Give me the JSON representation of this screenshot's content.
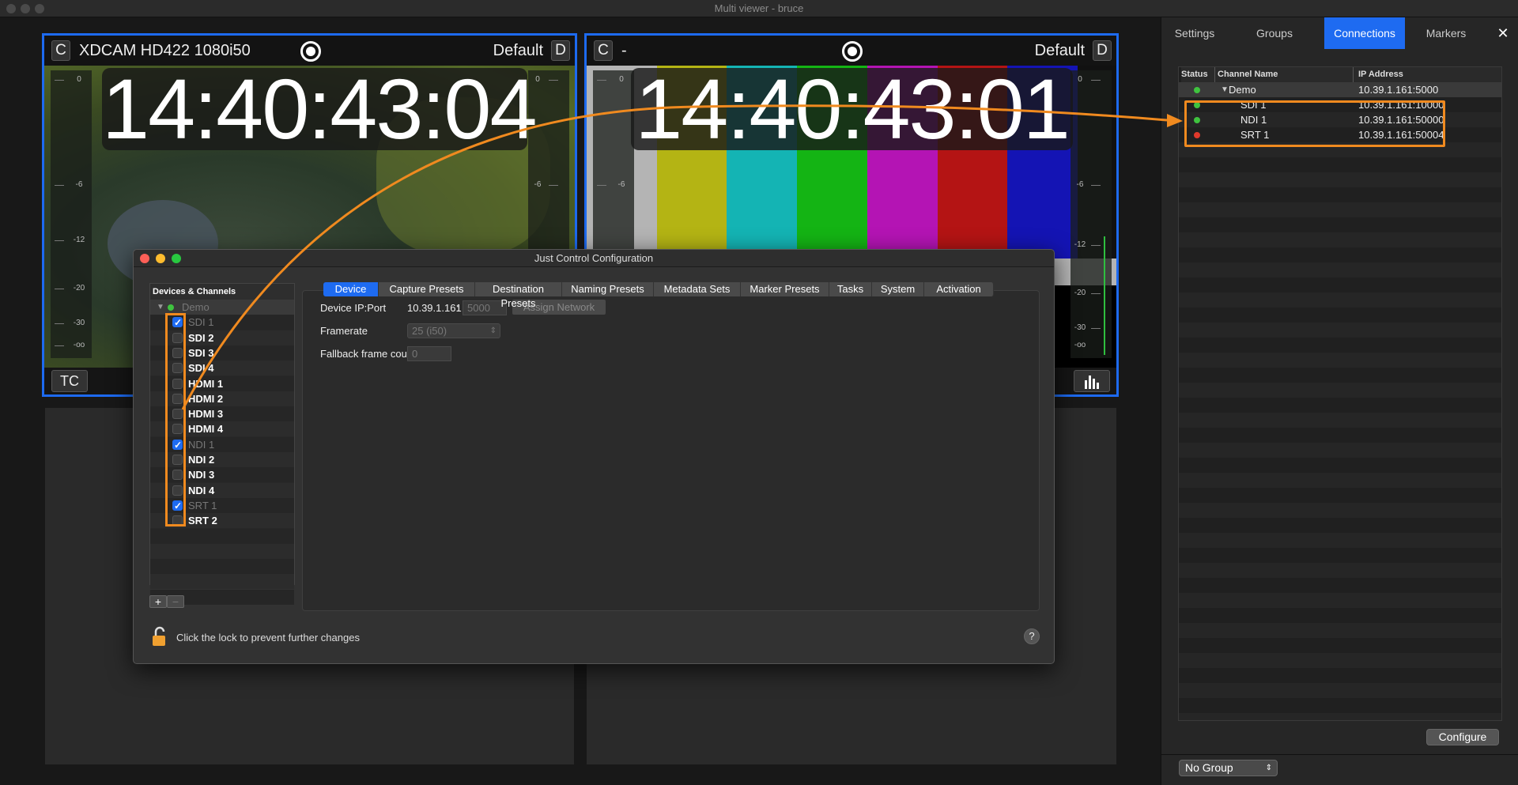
{
  "window": {
    "title": "Multi viewer - bruce"
  },
  "viewer1": {
    "c_label": "C",
    "format": "XDCAM HD422 1080i50",
    "preset": "Default",
    "d_label": "D",
    "timecode": "14:40:43:04",
    "footer_label": "TC"
  },
  "viewer2": {
    "c_label": "C",
    "format": "-",
    "preset": "Default",
    "d_label": "D",
    "timecode": "14:40:43:01"
  },
  "meter_ticks": [
    "0",
    "-6",
    "-12",
    "-20",
    "-30",
    "-oo"
  ],
  "panel": {
    "tabs": [
      {
        "label": "Settings"
      },
      {
        "label": "Groups"
      },
      {
        "label": "Connections"
      },
      {
        "label": "Markers"
      }
    ],
    "close": "✕",
    "table": {
      "headers": {
        "status": "Status",
        "channel": "Channel Name",
        "ip": "IP Address"
      },
      "group": {
        "name": "Demo",
        "ip": "10.39.1.161:5000",
        "status": "green"
      },
      "rows": [
        {
          "name": "SDI 1",
          "ip": "10.39.1.161:10000",
          "status": "green"
        },
        {
          "name": "NDI 1",
          "ip": "10.39.1.161:50000",
          "status": "green"
        },
        {
          "name": "SRT 1",
          "ip": "10.39.1.161:50004",
          "status": "red"
        }
      ]
    },
    "configure": "Configure",
    "group_select": "No Group"
  },
  "dialog": {
    "title": "Just Control Configuration",
    "list_header": "Devices & Channels",
    "device": "Demo",
    "channels": [
      {
        "name": "SDI 1",
        "checked": true
      },
      {
        "name": "SDI 2",
        "checked": false
      },
      {
        "name": "SDI 3",
        "checked": false
      },
      {
        "name": "SDI 4",
        "checked": false
      },
      {
        "name": "HDMI 1",
        "checked": false
      },
      {
        "name": "HDMI 2",
        "checked": false
      },
      {
        "name": "HDMI 3",
        "checked": false
      },
      {
        "name": "HDMI 4",
        "checked": false
      },
      {
        "name": "NDI 1",
        "checked": true
      },
      {
        "name": "NDI 2",
        "checked": false
      },
      {
        "name": "NDI 3",
        "checked": false
      },
      {
        "name": "NDI 4",
        "checked": false
      },
      {
        "name": "SRT 1",
        "checked": true
      },
      {
        "name": "SRT 2",
        "checked": false
      }
    ],
    "add": "+",
    "remove": "−",
    "tabs": [
      "Device",
      "Capture Presets",
      "Destination Presets",
      "Naming Presets",
      "Metadata Sets",
      "Marker Presets",
      "Tasks",
      "System",
      "Activation"
    ],
    "device_ip_label": "Device IP:Port",
    "device_ip": "10.39.1.161",
    "colon": ":",
    "port": "5000",
    "assign": "Assign Network",
    "framerate_label": "Framerate",
    "framerate": "25 (i50)",
    "fallback_label": "Fallback frame count",
    "fallback": "0",
    "lock_text": "Click the lock to prevent further changes",
    "help": "?"
  },
  "colors": {
    "accent": "#1e6bf1",
    "highlight": "#f08a1f",
    "status_green": "#3fc33f",
    "status_red": "#e0392b"
  }
}
